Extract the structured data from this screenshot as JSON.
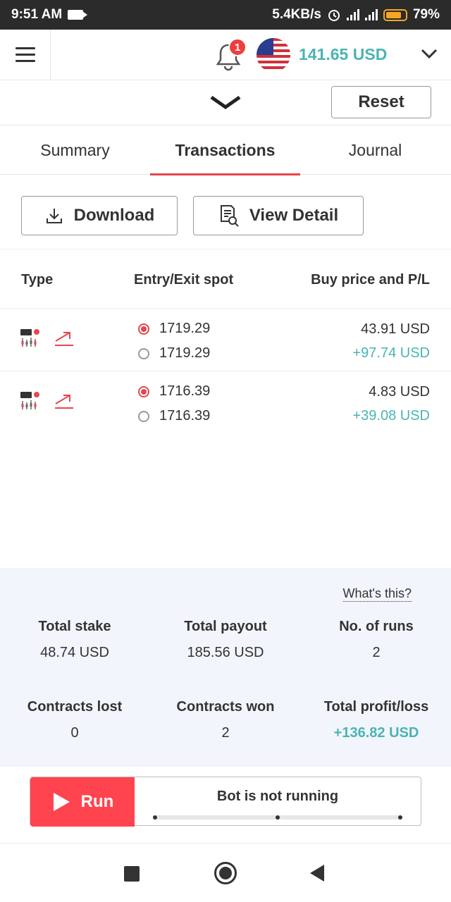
{
  "status_bar": {
    "time": "9:51 AM",
    "speed": "5.4KB/s",
    "network": "4G",
    "battery": "79%",
    "battery_level": 0.79
  },
  "header": {
    "notifications_count": "1",
    "currency_flag": "us-flag-icon",
    "balance": "141.65 USD"
  },
  "toolbar": {
    "reset_label": "Reset"
  },
  "tabs": [
    {
      "label": "Summary",
      "active": false
    },
    {
      "label": "Transactions",
      "active": true
    },
    {
      "label": "Journal",
      "active": false
    }
  ],
  "actions": {
    "download_label": "Download",
    "view_detail_label": "View Detail"
  },
  "table": {
    "columns": [
      "Type",
      "Entry/Exit spot",
      "Buy price and P/L"
    ],
    "rows": [
      {
        "entry": "1719.29",
        "exit": "1719.29",
        "buy_price": "43.91 USD",
        "pl": "+97.74 USD"
      },
      {
        "entry": "1716.39",
        "exit": "1716.39",
        "buy_price": "4.83 USD",
        "pl": "+39.08 USD"
      }
    ]
  },
  "summary": {
    "whats_this": "What's this?",
    "stats": [
      {
        "label": "Total stake",
        "value": "48.74 USD"
      },
      {
        "label": "Total payout",
        "value": "185.56 USD"
      },
      {
        "label": "No. of runs",
        "value": "2"
      },
      {
        "label": "Contracts lost",
        "value": "0"
      },
      {
        "label": "Contracts won",
        "value": "2"
      },
      {
        "label": "Total profit/loss",
        "value": "+136.82 USD"
      }
    ]
  },
  "run": {
    "button_label": "Run",
    "status": "Bot is not running"
  },
  "colors": {
    "accent_red": "#ff444f",
    "profit_green": "#4bb4b3",
    "panel_bg": "#f2f5fb"
  }
}
